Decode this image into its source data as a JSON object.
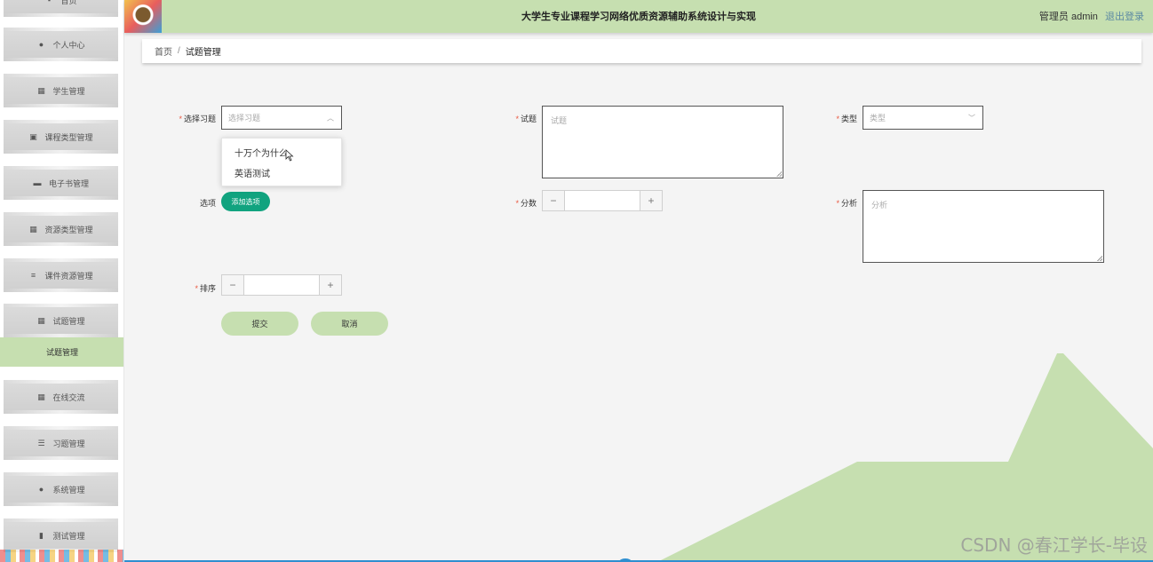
{
  "header": {
    "title": "大学生专业课程学习网络优质资源辅助系统设计与实现",
    "user_label": "管理员 admin",
    "logout_label": "退出登录"
  },
  "sidebar": {
    "items": [
      {
        "label": "首页",
        "icon": "home-icon"
      },
      {
        "label": "个人中心",
        "icon": "user-icon"
      },
      {
        "label": "学生管理",
        "icon": "grid-icon"
      },
      {
        "label": "课程类型管理",
        "icon": "image-icon"
      },
      {
        "label": "电子书管理",
        "icon": "briefcase-icon"
      },
      {
        "label": "资源类型管理",
        "icon": "grid-icon"
      },
      {
        "label": "课件资源管理",
        "icon": "sliders-icon"
      },
      {
        "label": "试题管理",
        "icon": "table-icon"
      },
      {
        "label": "在线交流",
        "icon": "grid-icon"
      },
      {
        "label": "习题管理",
        "icon": "list-icon"
      },
      {
        "label": "系统管理",
        "icon": "user-icon"
      },
      {
        "label": "测试管理",
        "icon": "bar-chart-icon"
      }
    ],
    "active_sub": "试题管理"
  },
  "breadcrumb": {
    "home": "首页",
    "separator": "/",
    "current": "试题管理"
  },
  "form": {
    "exercise_label": "选择习题",
    "exercise_placeholder": "选择习题",
    "question_label": "试题",
    "question_placeholder": "试题",
    "type_label": "类型",
    "type_placeholder": "类型",
    "options_label": "选项",
    "add_option_button": "添加选项",
    "score_label": "分数",
    "analysis_label": "分析",
    "analysis_placeholder": "分析",
    "sort_label": "排序",
    "submit_button": "提交",
    "cancel_button": "取消",
    "exercise_options": [
      "十万个为什么",
      "英语测试"
    ]
  },
  "watermark": "CSDN @春江学长-毕设",
  "colors": {
    "accent_green": "#c6dfb0",
    "add_button": "#11a37f",
    "required_mark": "#e9573f"
  }
}
